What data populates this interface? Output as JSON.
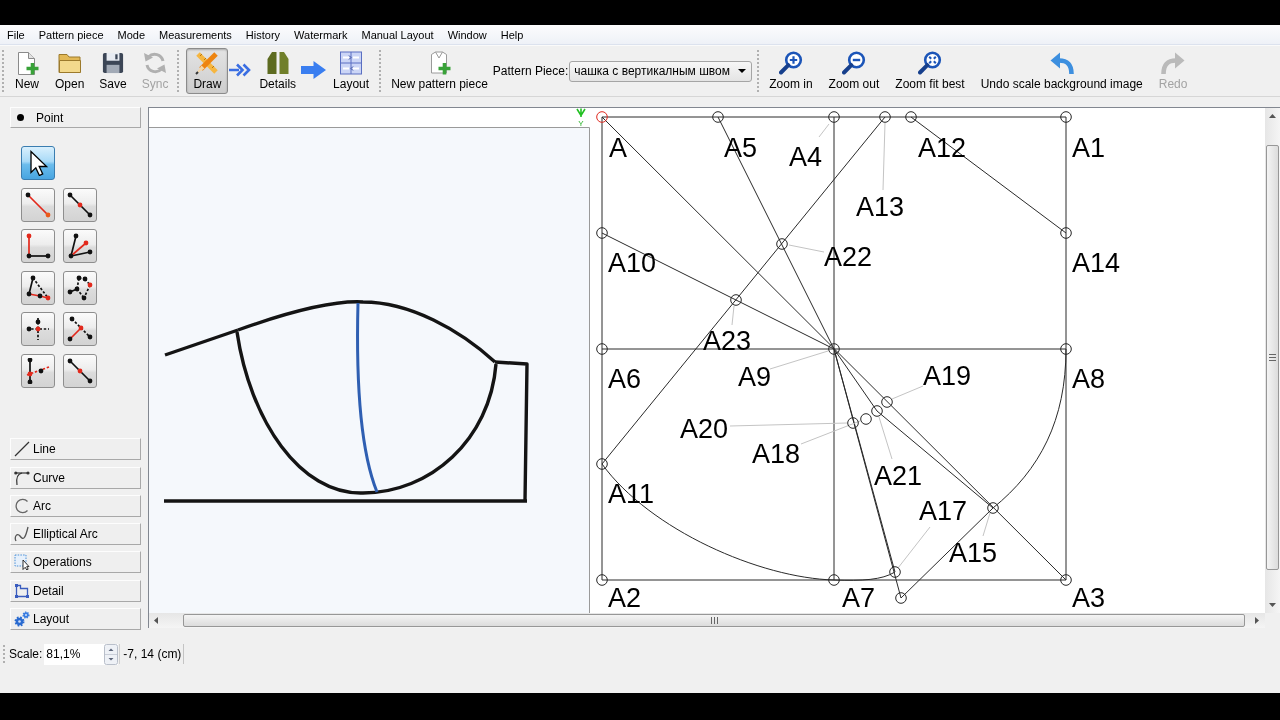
{
  "menu": [
    "File",
    "Pattern piece",
    "Mode",
    "Measurements",
    "History",
    "Watermark",
    "Manual Layout",
    "Window",
    "Help"
  ],
  "toolbar": {
    "file_buttons": [
      {
        "label": "New",
        "disabled": false
      },
      {
        "label": "Open",
        "disabled": false
      },
      {
        "label": "Save",
        "disabled": false
      },
      {
        "label": "Sync",
        "disabled": true
      }
    ],
    "modes": [
      {
        "label": "Draw",
        "selected": true
      },
      {
        "label": "Details",
        "selected": false
      },
      {
        "label": "Layout",
        "selected": false
      }
    ],
    "new_piece_button": {
      "label": "New pattern piece"
    },
    "pattern_piece": {
      "label": "Pattern Piece:",
      "value": "чашка с вертикалным швом"
    },
    "view_buttons": [
      {
        "label": "Zoom in",
        "disabled": false
      },
      {
        "label": "Zoom out",
        "disabled": false
      },
      {
        "label": "Zoom fit best",
        "disabled": false
      },
      {
        "label": "Undo scale background image",
        "disabled": false
      },
      {
        "label": "Redo",
        "disabled": true
      }
    ]
  },
  "tool_panel": {
    "point_group": "Point",
    "tools": [
      {
        "selected": true
      },
      {
        "selected": false
      },
      {
        "selected": false
      },
      {
        "selected": false
      },
      {
        "selected": false
      },
      {
        "selected": false
      },
      {
        "selected": false
      },
      {
        "selected": false
      },
      {
        "selected": false
      },
      {
        "selected": false
      },
      {
        "selected": false
      }
    ],
    "groups": [
      "Line",
      "Curve",
      "Arc",
      "Elliptical Arc",
      "Operations",
      "Detail",
      "Layout"
    ]
  },
  "canvas": {
    "axis_label": "Y",
    "points": [
      {
        "label": "A",
        "kind": "base"
      },
      {
        "label": "A5",
        "kind": "point"
      },
      {
        "label": "A4",
        "kind": "point"
      },
      {
        "label": "A12",
        "kind": "point"
      },
      {
        "label": "A1",
        "kind": "point"
      },
      {
        "label": "A13",
        "kind": "point"
      },
      {
        "label": "A10",
        "kind": "point"
      },
      {
        "label": "A22",
        "kind": "point"
      },
      {
        "label": "A14",
        "kind": "point"
      },
      {
        "label": "A23",
        "kind": "point"
      },
      {
        "label": "A6",
        "kind": "point"
      },
      {
        "label": "A9",
        "kind": "point"
      },
      {
        "label": "A19",
        "kind": "point"
      },
      {
        "label": "A8",
        "kind": "point"
      },
      {
        "label": "A20",
        "kind": "point"
      },
      {
        "label": "A18",
        "kind": "point"
      },
      {
        "label": "A21",
        "kind": "point"
      },
      {
        "label": "A11",
        "kind": "point"
      },
      {
        "label": "A17",
        "kind": "point"
      },
      {
        "label": "A15",
        "kind": "point"
      },
      {
        "label": "A2",
        "kind": "point"
      },
      {
        "label": "A7",
        "kind": "point"
      },
      {
        "label": "A3",
        "kind": "point"
      },
      {
        "kind": "point"
      }
    ]
  },
  "status_bar": {
    "scale_label": "Scale:",
    "scale_value": "81,1%",
    "coordinates": "-7, 14 (cm)"
  }
}
